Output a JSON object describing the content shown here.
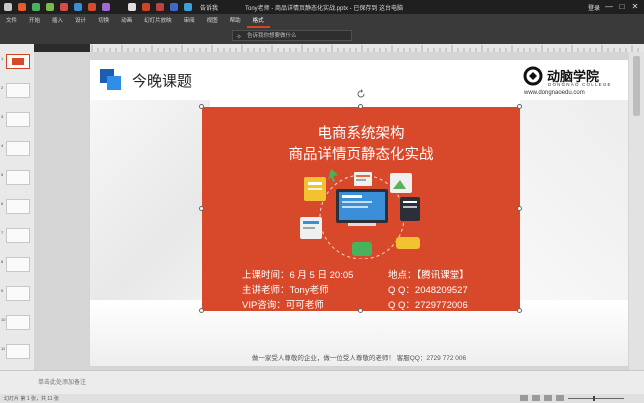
{
  "window": {
    "title": "Tony老师 - 商品详情页静态化实战.pptx - 已保存到 这台电脑",
    "tell_me": "告诉我",
    "user": "登录",
    "controls": [
      "—",
      "□",
      "✕"
    ]
  },
  "ribbon": {
    "tabs": [
      "文件",
      "开始",
      "插入",
      "设计",
      "切换",
      "动画",
      "幻灯片放映",
      "审阅",
      "视图",
      "帮助",
      "格式"
    ],
    "active_tab": "格式",
    "search_placeholder": "告诉我你想要做什么"
  },
  "thumbnails": {
    "numbers": [
      "1",
      "2",
      "3",
      "4",
      "5",
      "6",
      "7",
      "8",
      "9",
      "10",
      "11"
    ],
    "active_index": 0
  },
  "slide": {
    "heading": "今晚课题",
    "logo": {
      "name": "动脑学院",
      "english": "DONGNAO COLLEGE",
      "url": "www.dongnaoedu.com"
    },
    "banner": {
      "line1": "电商系统架构",
      "line2": "商品详情页静态化实战",
      "time": "上课时间：6 月 5 日 20:05",
      "teacher": "主讲老师：Tony老师",
      "vip": "VIP咨询：可可老师",
      "location": "地点：【腾讯课堂】",
      "qq1": "Q Q：2048209527",
      "qq2": "Q Q：2729772006"
    },
    "footer": "做一家受人尊敬的企业，做一位受人尊敬的老师！  客服QQ：2729 772 006"
  },
  "notes": {
    "placeholder": "单击此处添加备注"
  },
  "status": {
    "left": "幻灯片 第 1 张，共 11 张"
  },
  "colors": {
    "banner": "#d7492a",
    "accent": "#d04423",
    "title_icon_dark": "#1a5fb4",
    "title_icon_light": "#2f8ee6"
  }
}
